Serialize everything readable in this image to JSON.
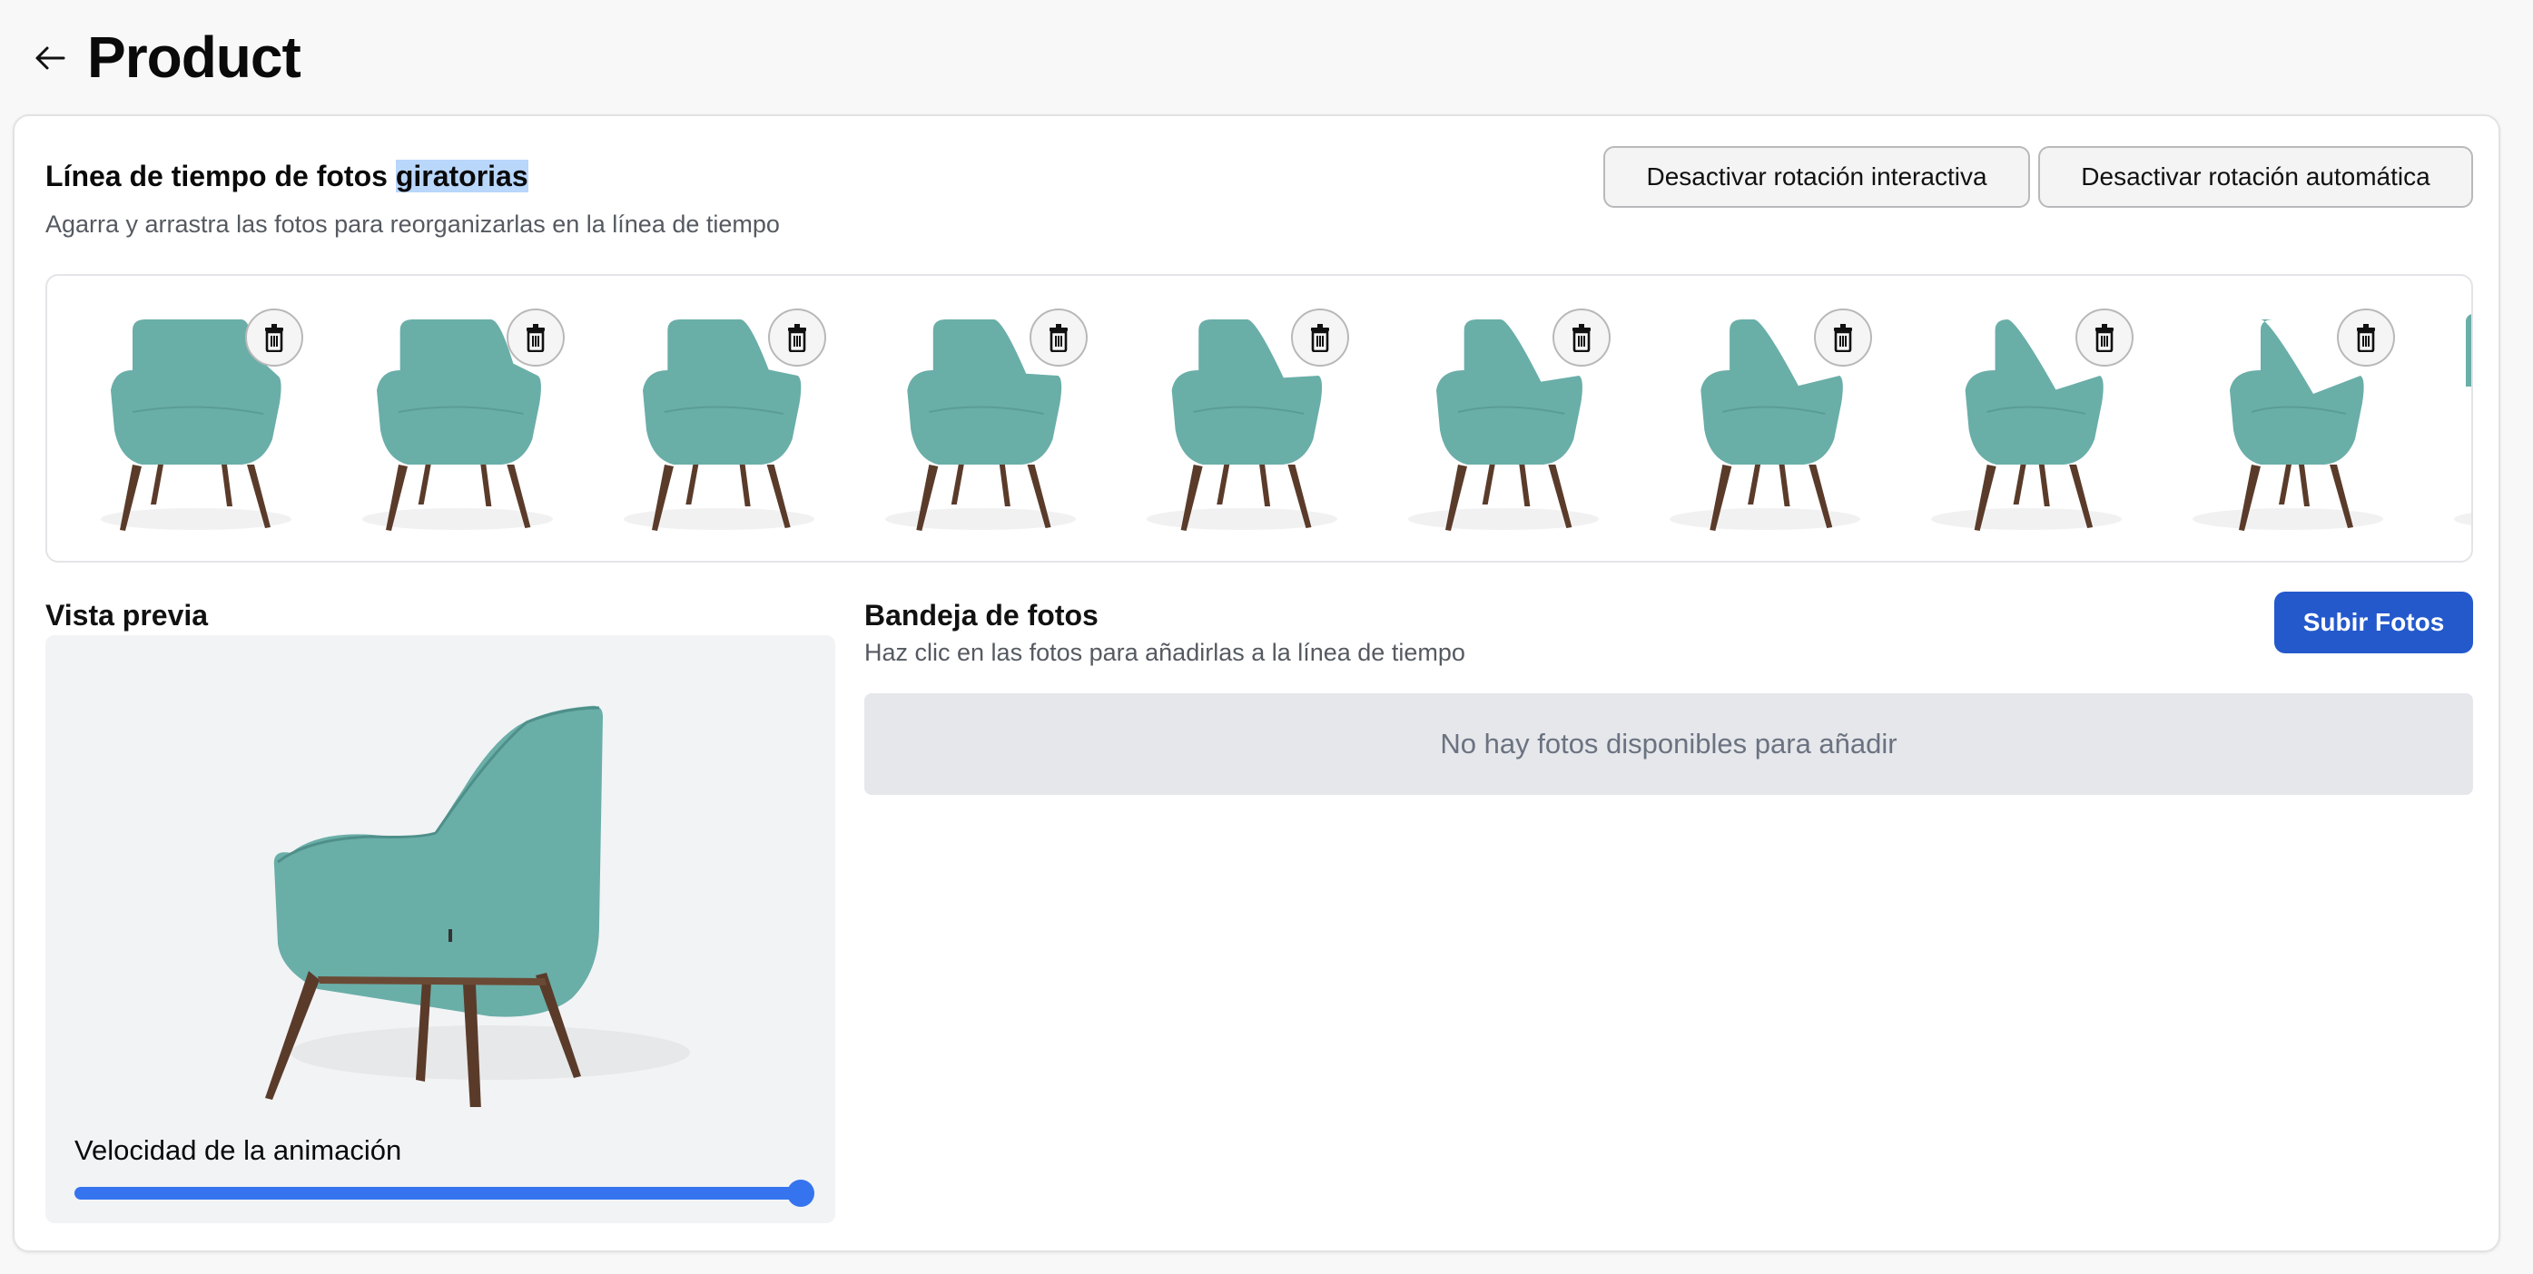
{
  "header": {
    "back_icon": "arrow-left-icon",
    "title": "Product"
  },
  "timeline": {
    "title_main": "Línea de tiempo de fotos ",
    "title_highlighted": "giratorias",
    "subtitle": "Agarra y arrastra las fotos para reorganizarlas en la línea de tiempo",
    "buttons": {
      "disable_interactive": "Desactivar rotación interactiva",
      "disable_auto": "Desactivar rotación automática"
    },
    "photos": [
      {
        "view": "front",
        "angle": 0,
        "delete_icon": "trash-icon"
      },
      {
        "view": "front-slight-left",
        "angle": 15,
        "delete_icon": "trash-icon"
      },
      {
        "view": "three-quarter",
        "angle": 30,
        "delete_icon": "trash-icon"
      },
      {
        "view": "three-quarter",
        "angle": 40,
        "delete_icon": "trash-icon"
      },
      {
        "view": "three-quarter",
        "angle": 50,
        "delete_icon": "trash-icon"
      },
      {
        "view": "three-quarter",
        "angle": 60,
        "delete_icon": "trash-icon"
      },
      {
        "view": "side-three-quarter",
        "angle": 70,
        "delete_icon": "trash-icon"
      },
      {
        "view": "side-three-quarter",
        "angle": 80,
        "delete_icon": "trash-icon"
      },
      {
        "view": "side",
        "angle": 90,
        "delete_icon": "trash-icon"
      },
      {
        "view": "side-partial",
        "angle": 100,
        "delete_icon": "trash-icon"
      }
    ]
  },
  "preview": {
    "title": "Vista previa",
    "speed_label": "Velocidad de la animación",
    "speed_value_percent": 100
  },
  "tray": {
    "title": "Bandeja de fotos",
    "subtitle": "Haz clic en las fotos para añadirlas a la línea de tiempo",
    "upload_button": "Subir Fotos",
    "empty_message": "No hay fotos disponibles para añadir"
  },
  "colors": {
    "accent": "#2459cc",
    "slider": "#3574ee",
    "chair_fabric": "#6aaea8",
    "chair_wood": "#5a3b2a",
    "selection_highlight": "#b9d6fb"
  }
}
